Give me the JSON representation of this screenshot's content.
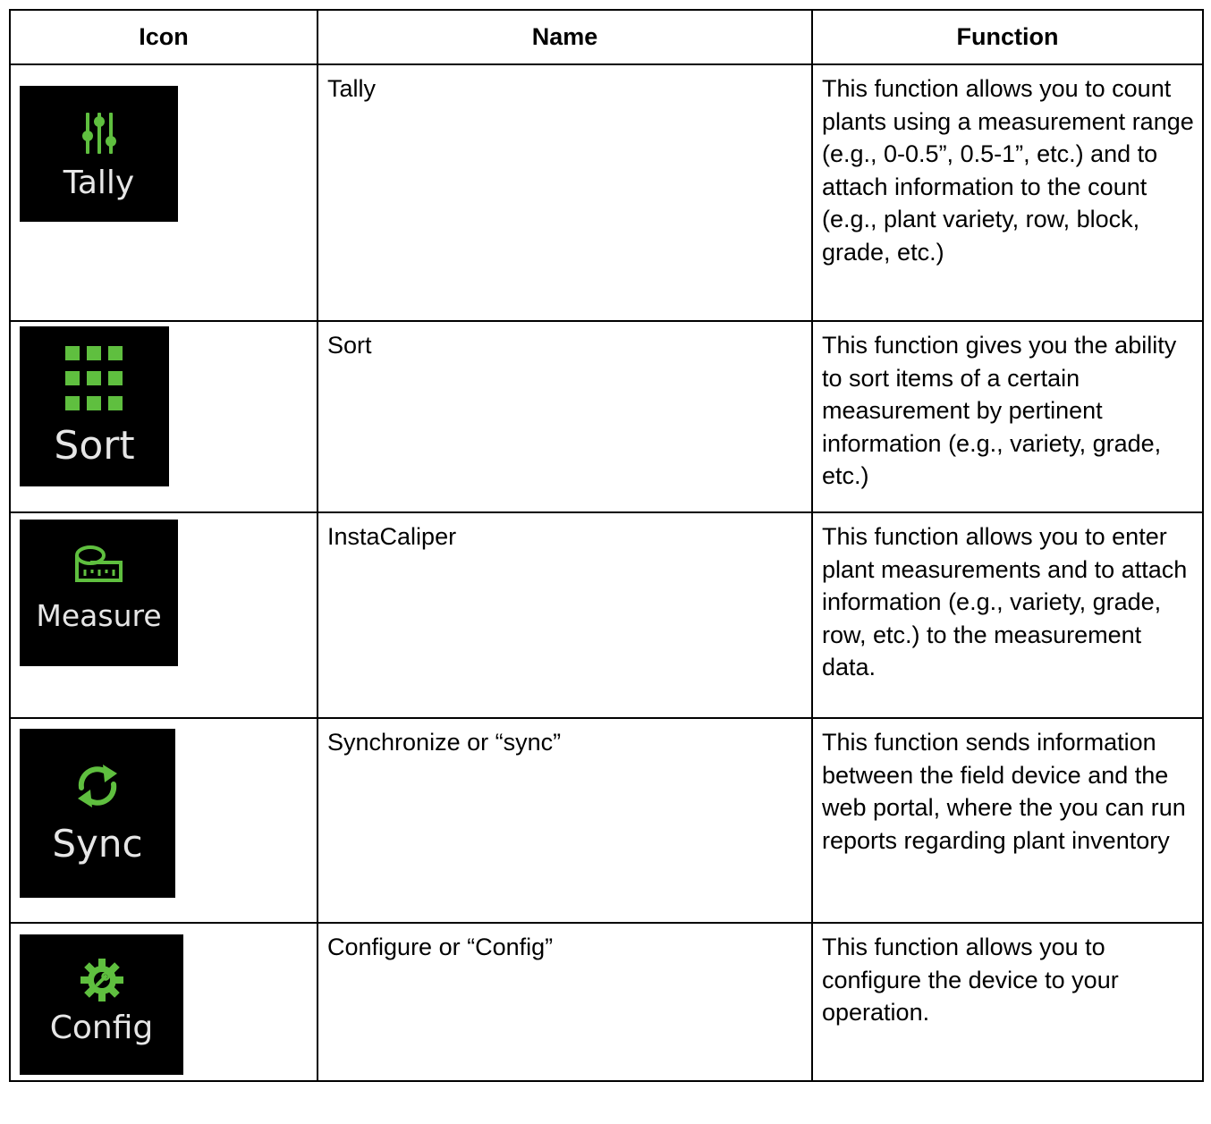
{
  "table": {
    "headers": {
      "icon": "Icon",
      "name": "Name",
      "function": "Function"
    },
    "rows": [
      {
        "icon": "tally-sliders-icon",
        "icon_label": "Tally",
        "name": "Tally",
        "function": "This function allows you to count plants using a measurement range (e.g., 0-0.5”, 0.5-1”, etc.) and to attach information to the count (e.g., plant variety, row, block, grade, etc.)"
      },
      {
        "icon": "sort-grid-icon",
        "icon_label": "Sort",
        "name": "Sort",
        "function": "This function gives you the ability to sort items of a certain measurement by pertinent information (e.g., variety, grade, etc.)"
      },
      {
        "icon": "measure-tape-icon",
        "icon_label": "Measure",
        "name": "InstaCaliper",
        "function": "This function allows you to enter plant measurements and to attach information (e.g., variety, grade, row, etc.) to the measurement data."
      },
      {
        "icon": "sync-arrows-icon",
        "icon_label": "Sync",
        "name": "Synchronize or “sync”",
        "function": "This function sends information between the field device and the web portal, where the you can run reports regarding plant inventory"
      },
      {
        "icon": "config-gear-icon",
        "icon_label": "Config",
        "name": "Configure or “Config”",
        "function": "This function allows you to configure the device to your operation."
      }
    ]
  },
  "colors": {
    "icon_background": "#000000",
    "icon_accent": "#5fbf3f",
    "icon_label": "#e6e6e6"
  }
}
